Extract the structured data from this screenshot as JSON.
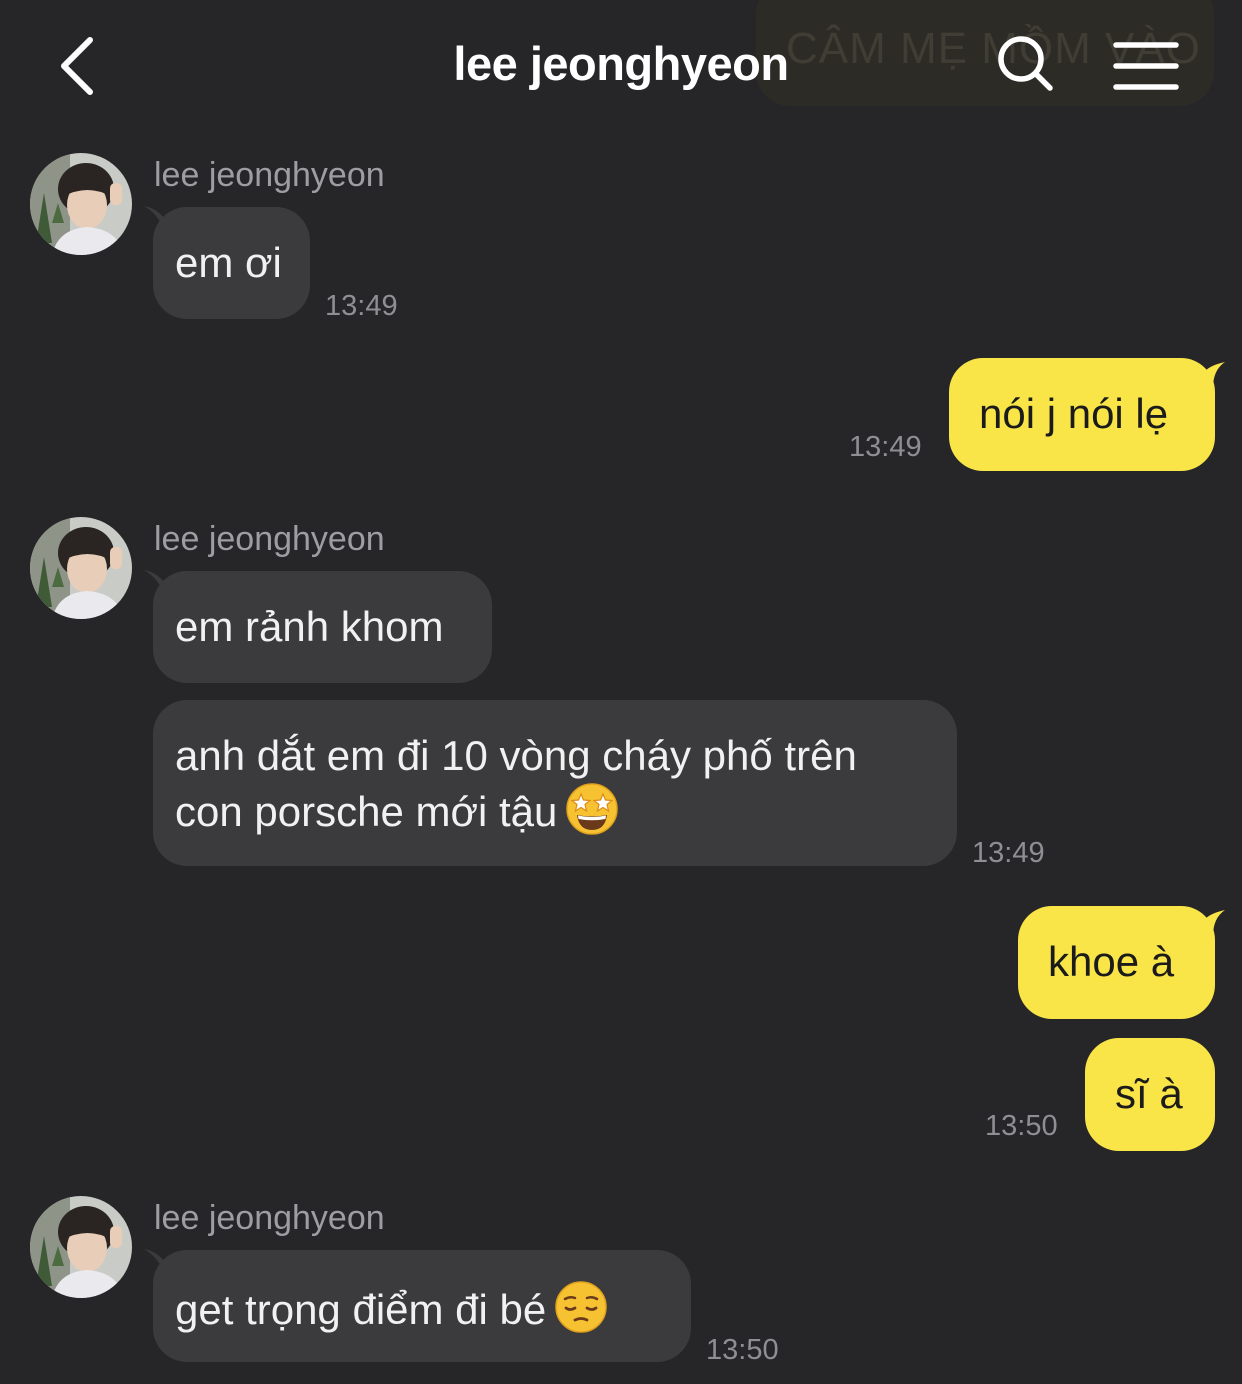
{
  "header": {
    "title": "lee jeonghyeon",
    "ghost_text": "CÂM MẸ MỒM VÀO"
  },
  "colors": {
    "background": "#262629",
    "incoming_bubble": "#3b3b3e",
    "outgoing_bubble": "#f9e547",
    "timestamp": "#8e8e93"
  },
  "messages": {
    "g1_sender": "lee jeonghyeon",
    "g1_m1": "em ơi",
    "g1_time": "13:49",
    "o1_m1": "nói j nói lẹ",
    "o1_time": "13:49",
    "g2_sender": "lee jeonghyeon",
    "g2_m1": "em rảnh khom",
    "g2_m2_line1": "anh dắt em đi 10 vòng cháy phố trên",
    "g2_m2_line2": "con porsche mới tậu",
    "g2_m2_emoji": "star-struck-emoji",
    "g2_time": "13:49",
    "o2_m1": "khoe à",
    "o2_m2": "sĩ à",
    "o2_time": "13:50",
    "g3_sender": "lee jeonghyeon",
    "g3_m1": "get trọng điểm đi bé",
    "g3_m1_emoji": "pensive-face-emoji",
    "g3_time": "13:50"
  }
}
